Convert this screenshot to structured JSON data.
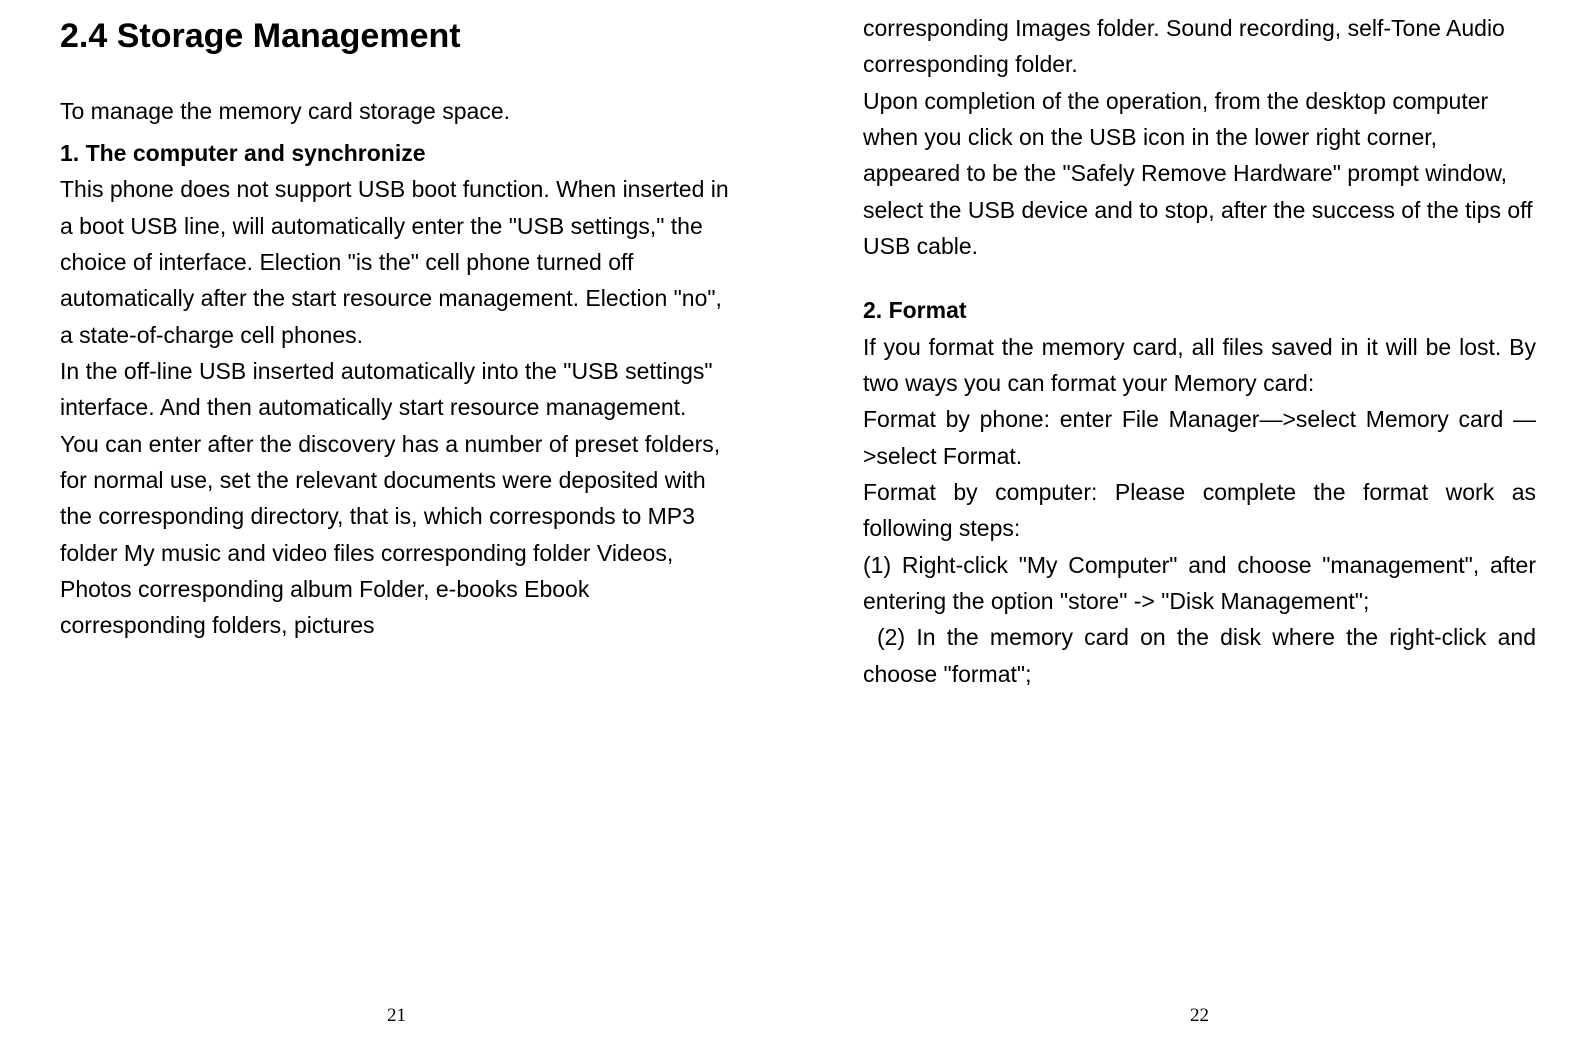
{
  "left": {
    "heading": "2.4  Storage Management",
    "intro": "To manage the memory card storage space.",
    "sub1": "1. The computer and synchronize",
    "p1": "This phone does not support USB boot function. When inserted in a boot USB line, will automatically enter the \"USB settings,\" the choice of interface. Election \"is the\" cell phone turned off automatically after the start resource management. Election \"no\", a state-of-charge cell phones.",
    "p2": "In the off-line USB inserted automatically into the \"USB settings\" interface. And then automatically start resource management.",
    "p3": "You can enter after the discovery has a number of preset folders, for normal use, set the relevant documents were deposited with the corresponding directory, that is, which corresponds to MP3 folder My music and video files corresponding folder Videos, Photos corresponding album Folder, e-books Ebook corresponding folders, pictures",
    "page_num": "21"
  },
  "right": {
    "p_cont": "corresponding Images folder. Sound recording, self-Tone Audio corresponding folder.",
    "p4": "Upon completion of the operation, from the desktop computer when you click on the USB icon in the lower right corner, appeared to be the \"Safely Remove Hardware\" prompt window, select the USB device and to stop, after the success of the tips off USB cable.",
    "sub2": "2.    Format",
    "p5": "If you format the memory card, all files saved in it will be lost. By two ways you can format your Memory card:",
    "p6": "Format by phone: enter File Manager—>select Memory card —>select Format.",
    "p7": "Format by computer: Please complete the format work as following steps:",
    "step1": "(1) Right-click \"My Computer\" and choose \"management\", after entering the option \"store\" -> \"Disk Management\";",
    "step2": "(2) In the memory card on the disk where the right-click and choose \"format\";",
    "page_num": "22"
  }
}
